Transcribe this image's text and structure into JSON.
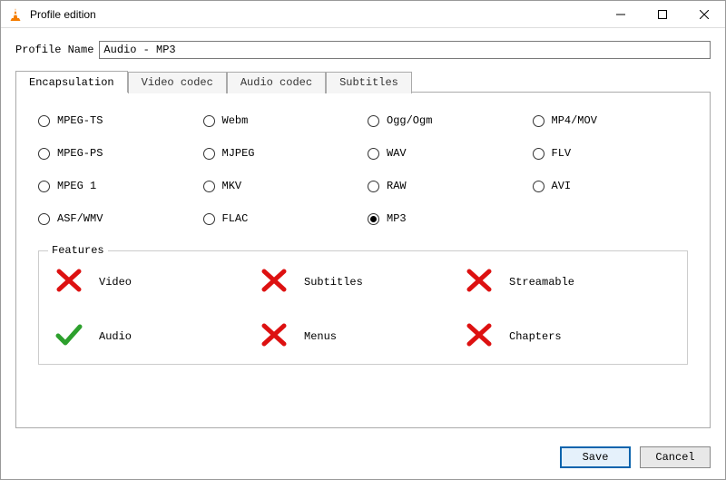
{
  "window": {
    "title": "Profile edition"
  },
  "profile": {
    "name_label": "Profile Name",
    "name_value": "Audio - MP3"
  },
  "tabs": {
    "items": [
      "Encapsulation",
      "Video codec",
      "Audio codec",
      "Subtitles"
    ],
    "active_index": 0
  },
  "encapsulation": {
    "options": [
      {
        "label": "MPEG-TS",
        "selected": false
      },
      {
        "label": "Webm",
        "selected": false
      },
      {
        "label": "Ogg/Ogm",
        "selected": false
      },
      {
        "label": "MP4/MOV",
        "selected": false
      },
      {
        "label": "MPEG-PS",
        "selected": false
      },
      {
        "label": "MJPEG",
        "selected": false
      },
      {
        "label": "WAV",
        "selected": false
      },
      {
        "label": "FLV",
        "selected": false
      },
      {
        "label": "MPEG 1",
        "selected": false
      },
      {
        "label": "MKV",
        "selected": false
      },
      {
        "label": "RAW",
        "selected": false
      },
      {
        "label": "AVI",
        "selected": false
      },
      {
        "label": "ASF/WMV",
        "selected": false
      },
      {
        "label": "FLAC",
        "selected": false
      },
      {
        "label": "MP3",
        "selected": true
      }
    ]
  },
  "features": {
    "legend": "Features",
    "items": [
      {
        "label": "Video",
        "supported": false
      },
      {
        "label": "Subtitles",
        "supported": false
      },
      {
        "label": "Streamable",
        "supported": false
      },
      {
        "label": "Audio",
        "supported": true
      },
      {
        "label": "Menus",
        "supported": false
      },
      {
        "label": "Chapters",
        "supported": false
      }
    ]
  },
  "footer": {
    "save": "Save",
    "cancel": "Cancel"
  }
}
